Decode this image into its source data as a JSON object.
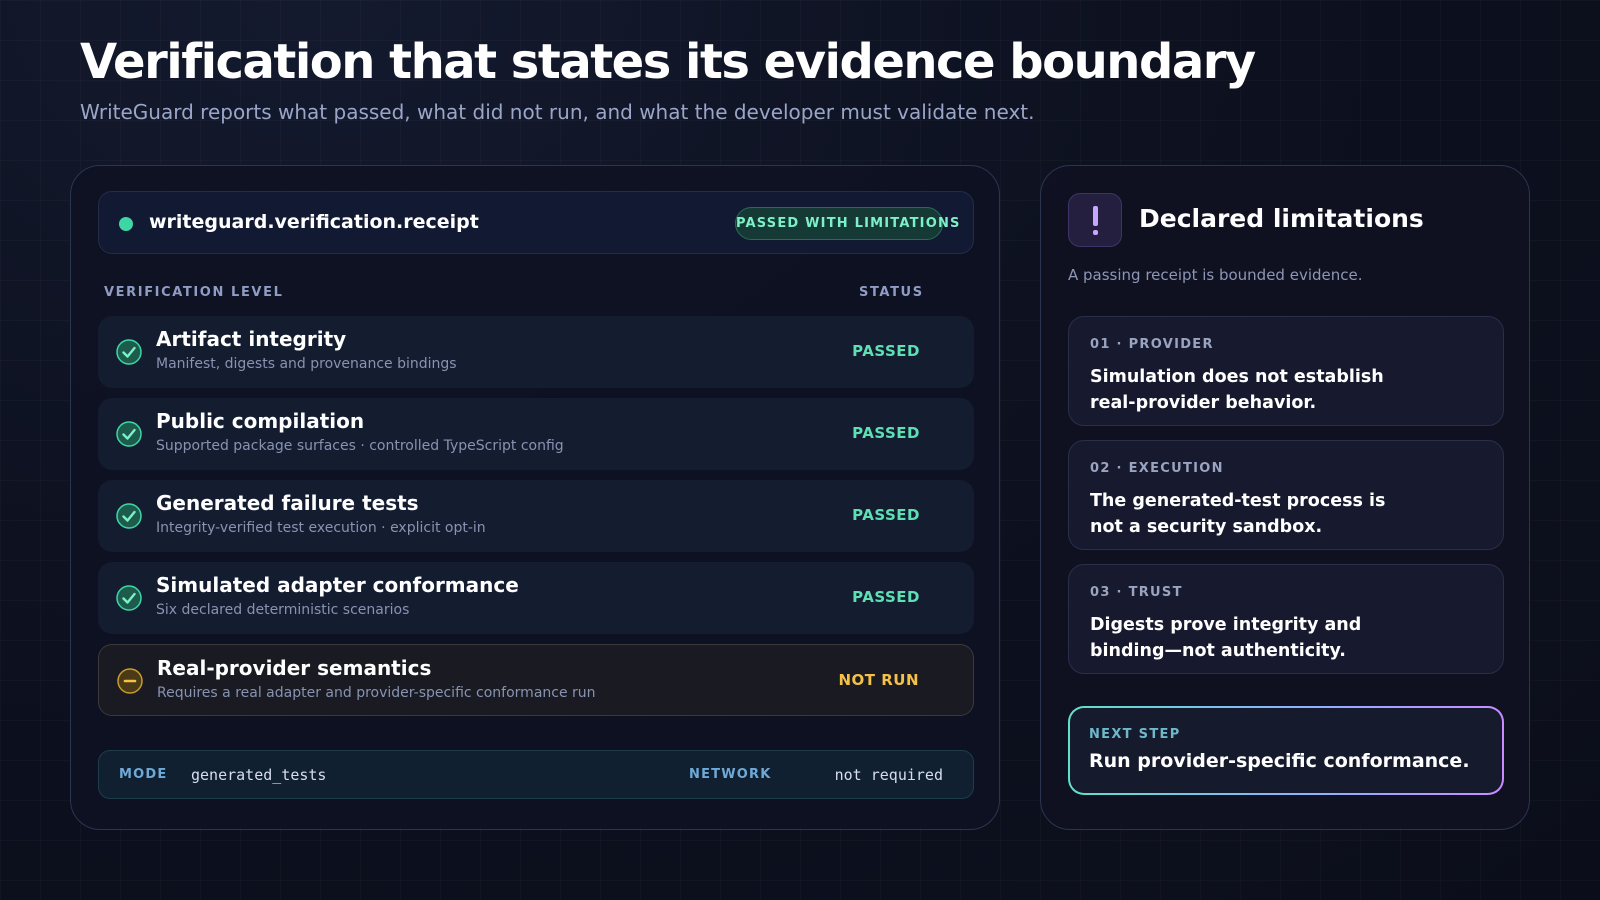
{
  "header": {
    "title": "Verification that states its evidence boundary",
    "subtitle": "WriteGuard reports what passed, what did not run, and what the developer must validate next."
  },
  "receipt": {
    "name": "writeguard.verification.receipt",
    "overall_status": "PASSED WITH LIMITATIONS",
    "columns": {
      "level": "VERIFICATION LEVEL",
      "status": "STATUS"
    },
    "checks": [
      {
        "title": "Artifact integrity",
        "description": "Manifest, digests and provenance bindings",
        "status": "PASSED",
        "icon": "check-circle-icon"
      },
      {
        "title": "Public compilation",
        "description": "Supported package surfaces · controlled TypeScript config",
        "status": "PASSED",
        "icon": "check-circle-icon"
      },
      {
        "title": "Generated failure tests",
        "description": "Integrity-verified test execution · explicit opt-in",
        "status": "PASSED",
        "icon": "check-circle-icon"
      },
      {
        "title": "Simulated adapter conformance",
        "description": "Six declared deterministic scenarios",
        "status": "PASSED",
        "icon": "check-circle-icon"
      },
      {
        "title": "Real-provider semantics",
        "description": "Requires a real adapter and provider-specific conformance run",
        "status": "NOT RUN",
        "icon": "minus-circle-icon"
      }
    ],
    "footer": {
      "mode_label": "MODE",
      "mode_value": "generated_tests",
      "network_label": "NETWORK",
      "network_value": "not required"
    }
  },
  "limitations": {
    "icon": "exclamation-icon",
    "title": "Declared limitations",
    "subtitle": "A passing receipt is bounded evidence.",
    "items": [
      {
        "label": "01 · PROVIDER",
        "text": "Simulation does not establish real-provider behavior."
      },
      {
        "label": "02 · EXECUTION",
        "text": "The generated-test process is not a security sandbox."
      },
      {
        "label": "03 · TRUST",
        "text": "Digests prove integrity and binding—not authenticity."
      }
    ],
    "next_step": {
      "label": "NEXT STEP",
      "text": "Run provider-specific conformance."
    }
  },
  "colors": {
    "pass": "#5fe0b4",
    "not_run": "#f6c147",
    "accent_purple": "#c8a6ff",
    "background": "#0d1120"
  }
}
